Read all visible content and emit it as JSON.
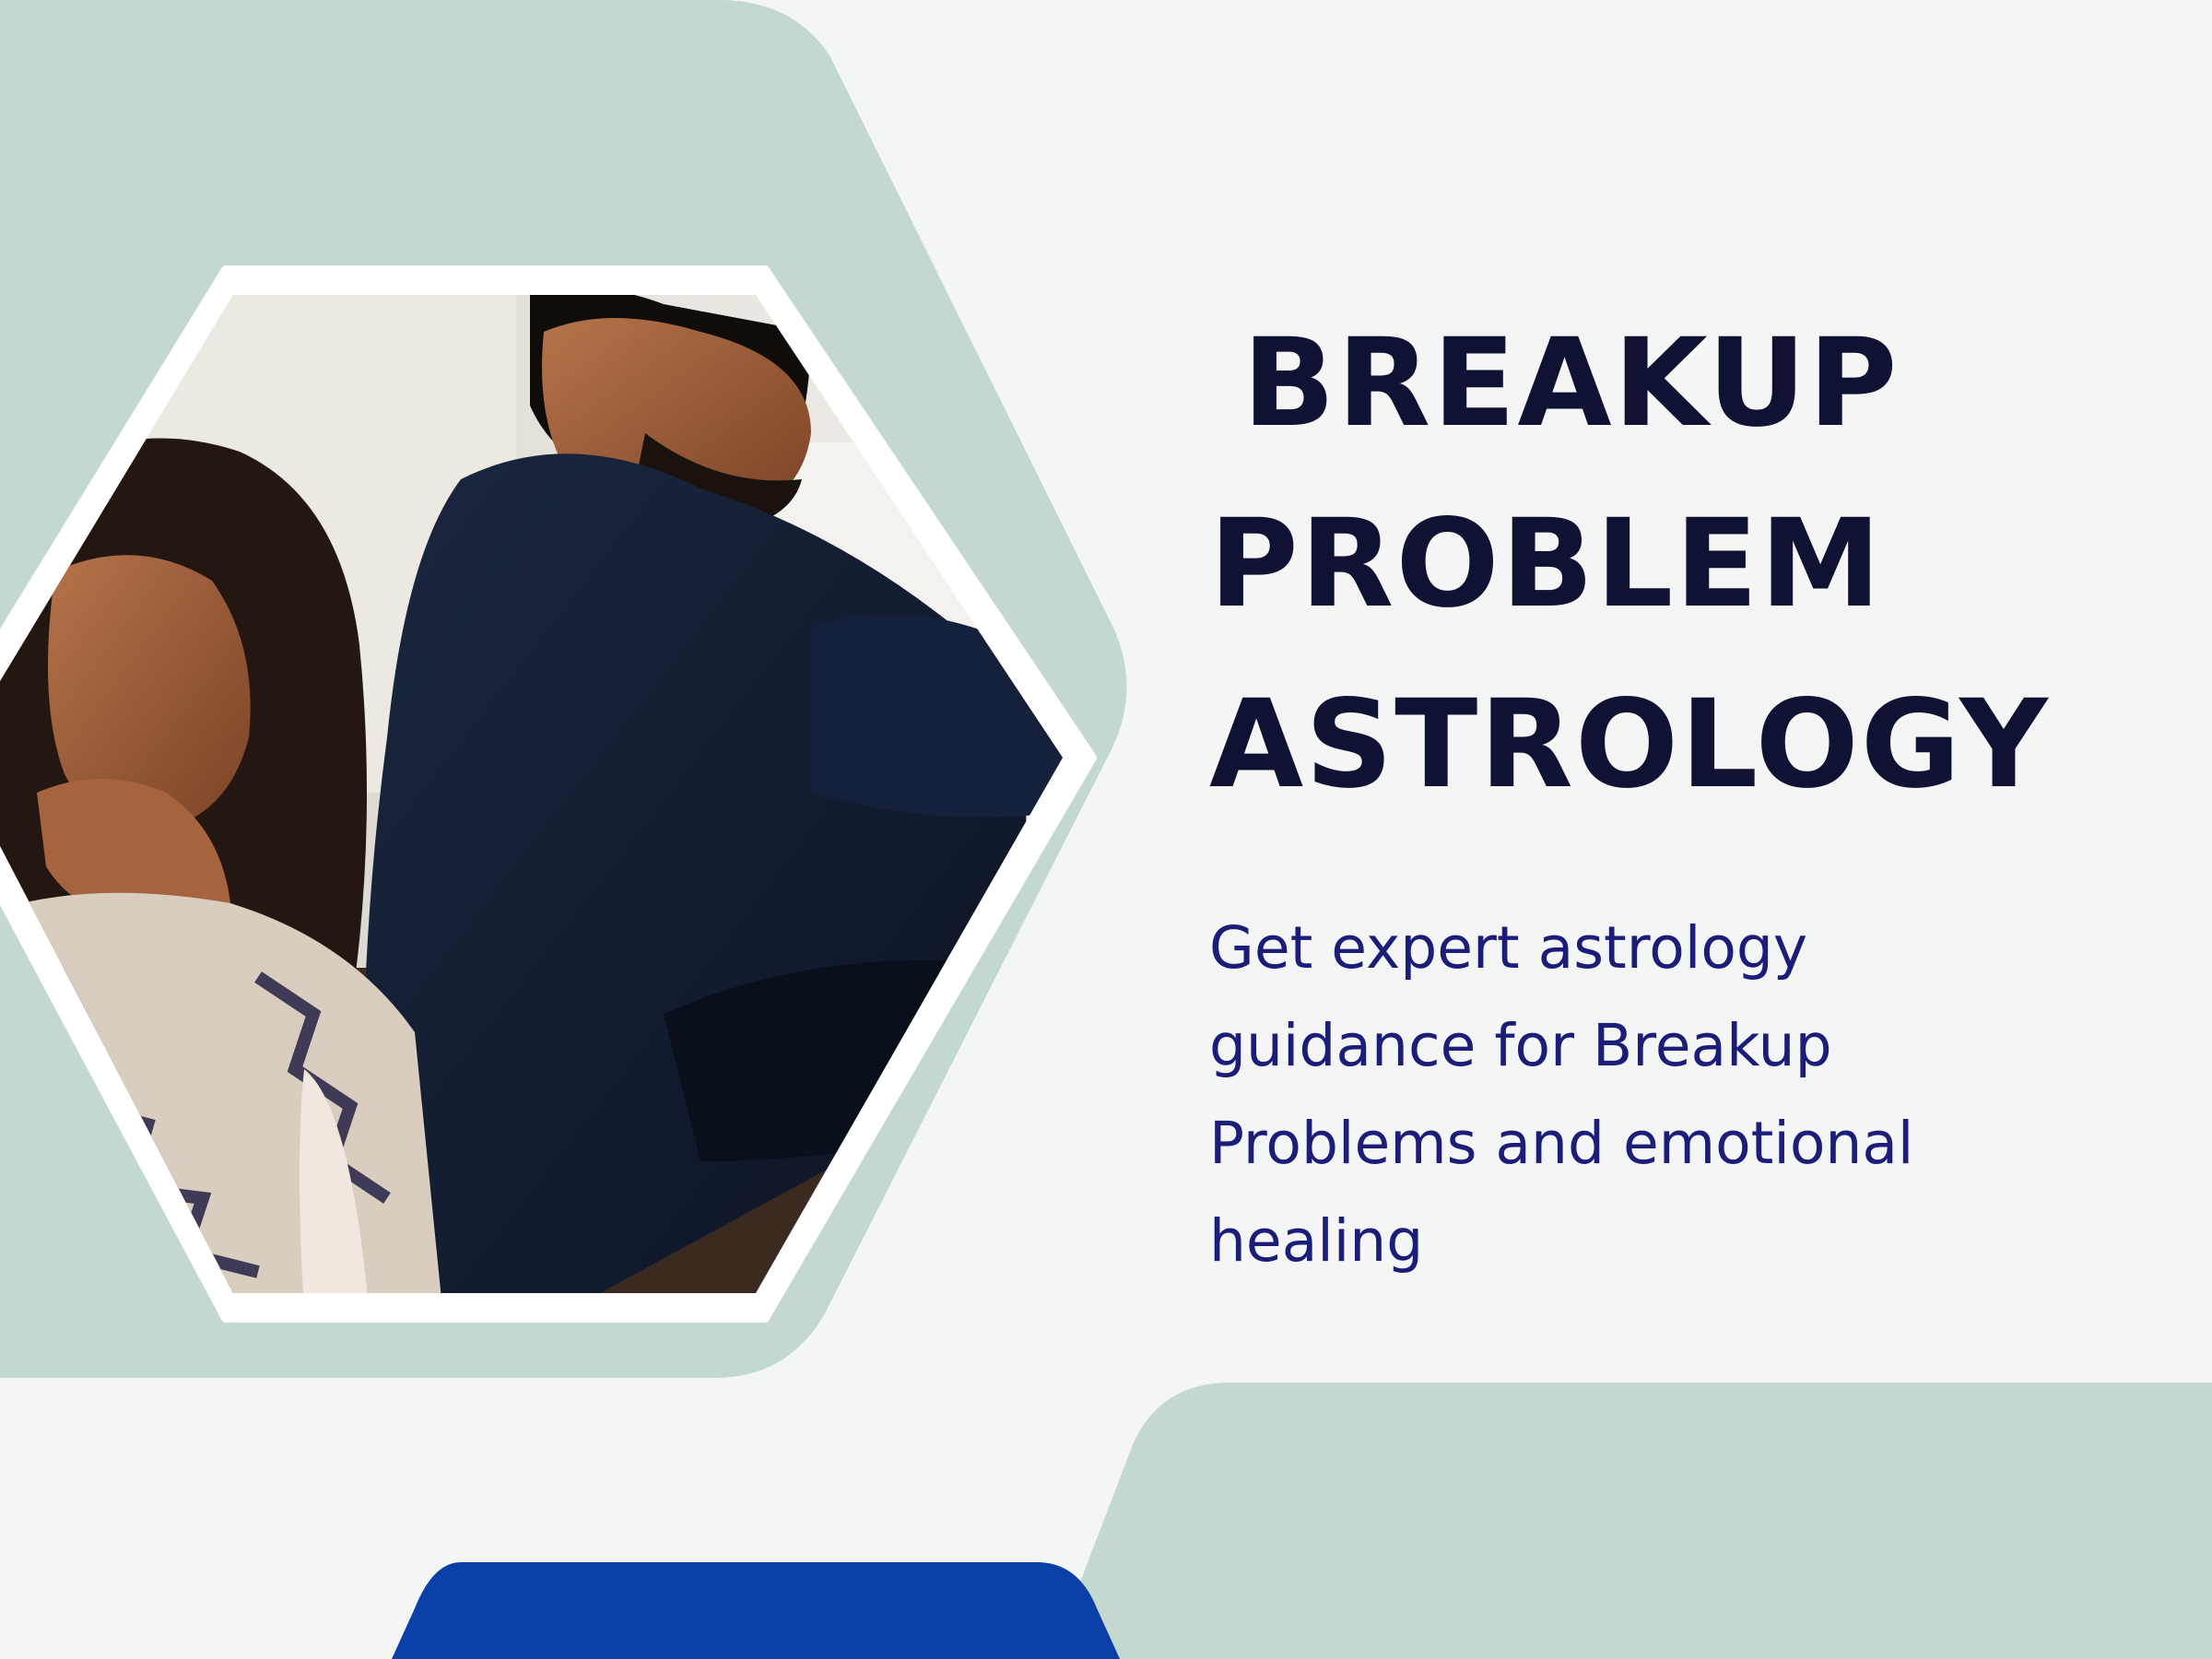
{
  "hero": {
    "title_lines": [
      "BREAKUP",
      "PROBLEM",
      "ASTROLOGY"
    ],
    "description_lines": [
      "Get expert astrology",
      "guidance for Breakup",
      "Problems and emotional",
      "healing"
    ]
  },
  "colors": {
    "page_background": "#f4f5f5",
    "mint_shape": "#c3d8cf",
    "title": "#0f1233",
    "description": "#1c1d78",
    "button": "#0b3fa8"
  },
  "photo": {
    "subject": "couple-sitting-back-to-back",
    "frame": "white-hexagon-border"
  },
  "cta_button": {
    "visible": "partial-top-edge"
  }
}
